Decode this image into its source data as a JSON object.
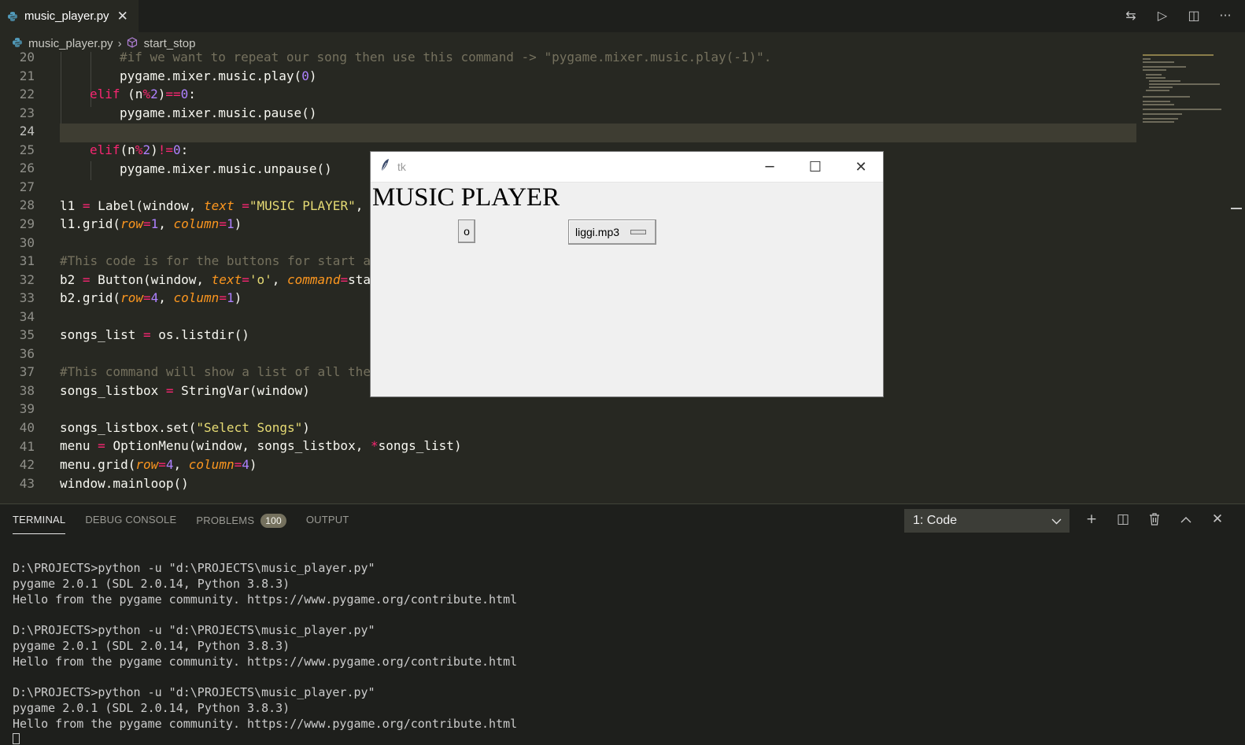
{
  "tab": {
    "title": "music_player.py",
    "close": "✕"
  },
  "breadcrumb": {
    "file": "music_player.py",
    "symbol": "start_stop"
  },
  "editor": {
    "active_line": "24",
    "lines": [
      {
        "n": "20",
        "t": ""
      },
      {
        "n": "21",
        "t": ""
      },
      {
        "n": "22",
        "t": ""
      },
      {
        "n": "23",
        "t": ""
      },
      {
        "n": "24",
        "t": ""
      },
      {
        "n": "25",
        "t": ""
      },
      {
        "n": "26",
        "t": ""
      },
      {
        "n": "27",
        "t": ""
      },
      {
        "n": "28",
        "t": ""
      },
      {
        "n": "29",
        "t": ""
      },
      {
        "n": "30",
        "t": ""
      },
      {
        "n": "31",
        "t": ""
      },
      {
        "n": "32",
        "t": ""
      },
      {
        "n": "33",
        "t": ""
      },
      {
        "n": "34",
        "t": ""
      },
      {
        "n": "35",
        "t": ""
      },
      {
        "n": "36",
        "t": ""
      },
      {
        "n": "37",
        "t": ""
      },
      {
        "n": "38",
        "t": ""
      },
      {
        "n": "39",
        "t": ""
      },
      {
        "n": "40",
        "t": ""
      },
      {
        "n": "41",
        "t": ""
      },
      {
        "n": "42",
        "t": ""
      },
      {
        "n": "43",
        "t": ""
      }
    ]
  },
  "code_tokens": {
    "l20": "#if we want to repeat our song then use this command -> \"pygame.mixer.music.play(-1)\".",
    "l21a": "pygame.mixer.music.play(",
    "l21b": "0",
    "l21c": ")",
    "l22a": "elif",
    "l22b": " (n",
    "l22c": "%",
    "l22d": "2",
    "l22e": ")",
    "l22f": "==",
    "l22g": "0",
    "l22h": ":",
    "l23": "pygame.mixer.music.pause()",
    "l25a": "elif",
    "l25b": "(n",
    "l25c": "%",
    "l25d": "2",
    "l25e": ")",
    "l25f": "!=",
    "l25g": "0",
    "l25h": ":",
    "l26": "pygame.mixer.music.unpause()",
    "l28a": "l1 ",
    "l28b": "=",
    "l28c": " Label(window, ",
    "l28d": "text",
    "l28e": " =",
    "l28f": "\"MUSIC PLAYER\"",
    "l28g": ", ",
    "l29a": "l1.grid(",
    "l29b": "row",
    "l29c": "=",
    "l29d": "1",
    "l29e": ", ",
    "l29f": "column",
    "l29g": "=",
    "l29h": "1",
    "l29i": ")",
    "l31": "#This code is for the buttons for start an",
    "l32a": "b2 ",
    "l32b": "=",
    "l32c": " Button(window, ",
    "l32d": "text",
    "l32e": "=",
    "l32f": "'o'",
    "l32g": ", ",
    "l32h": "command",
    "l32i": "=",
    "l32j": "star",
    "l33a": "b2.grid(",
    "l33b": "row",
    "l33c": "=",
    "l33d": "4",
    "l33e": ", ",
    "l33f": "column",
    "l33g": "=",
    "l33h": "1",
    "l33i": ")",
    "l35a": "songs_list ",
    "l35b": "=",
    "l35c": " os.listdir()",
    "l37": "#This command will show a list of all the",
    "l38a": "songs_listbox ",
    "l38b": "=",
    "l38c": " StringVar(window)",
    "l40a": "songs_listbox.set(",
    "l40b": "\"Select Songs\"",
    "l40c": ")",
    "l41a": "menu ",
    "l41b": "=",
    "l41c": " OptionMenu(window, songs_listbox, ",
    "l41d": "*",
    "l41e": "songs_list)",
    "l42a": "menu.grid(",
    "l42b": "row",
    "l42c": "=",
    "l42d": "4",
    "l42e": ", ",
    "l42f": "column",
    "l42g": "=",
    "l42h": "4",
    "l42i": ")",
    "l43": "window.mainloop()"
  },
  "tk_window": {
    "title": "tk",
    "label": "MUSIC PLAYER",
    "button": "o",
    "option_menu_value": "liggi.mp3"
  },
  "panel": {
    "tabs": [
      "TERMINAL",
      "DEBUG CONSOLE",
      "PROBLEMS",
      "OUTPUT"
    ],
    "problems_count": "100",
    "terminal_select": "1: Code"
  },
  "terminal": {
    "text": "D:\\PROJECTS>python -u \"d:\\PROJECTS\\music_player.py\"\npygame 2.0.1 (SDL 2.0.14, Python 3.8.3)\nHello from the pygame community. https://www.pygame.org/contribute.html\n\nD:\\PROJECTS>python -u \"d:\\PROJECTS\\music_player.py\"\npygame 2.0.1 (SDL 2.0.14, Python 3.8.3)\nHello from the pygame community. https://www.pygame.org/contribute.html\n\nD:\\PROJECTS>python -u \"d:\\PROJECTS\\music_player.py\"\npygame 2.0.1 (SDL 2.0.14, Python 3.8.3)\nHello from the pygame community. https://www.pygame.org/contribute.html"
  },
  "icons": {
    "python": "python-file-icon",
    "symbol": "method-symbol-icon",
    "compare": "⇆",
    "run": "▷",
    "split": "◫",
    "more": "···",
    "add": "+",
    "split_terminal": "◫",
    "trash": "🗑",
    "maximize": "︿",
    "close_panel": "✕",
    "chevron": "⌄",
    "breadcrumb_sep": "›",
    "feather": "🪶",
    "minimize": "─",
    "restore": "☐",
    "close": "✕"
  },
  "colors": {
    "keyword": "#f92672",
    "number": "#ae81ff",
    "string": "#e6db74",
    "comment": "#75715e",
    "param": "#fd971f"
  }
}
